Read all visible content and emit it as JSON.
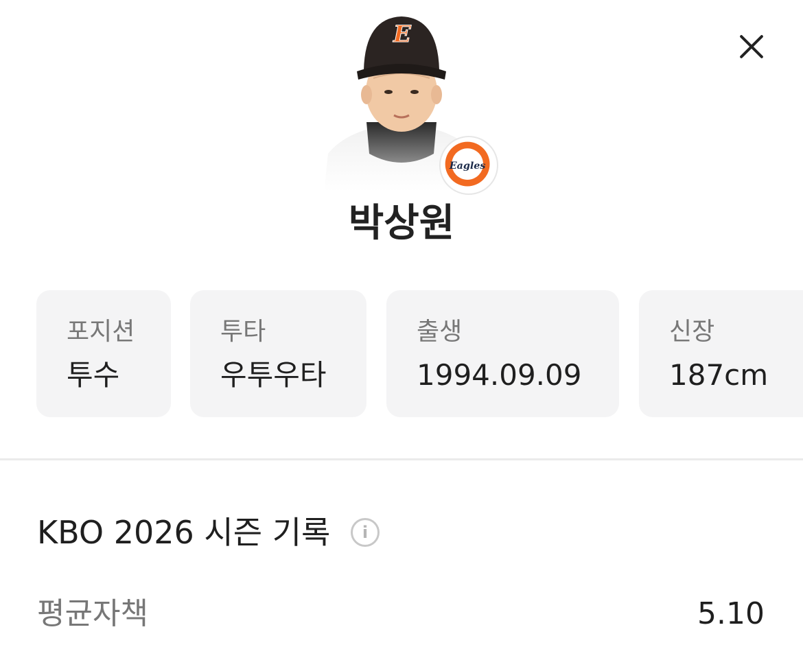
{
  "player": {
    "name": "박상원",
    "cap_letter": "E",
    "team_logo_text": "Eagles"
  },
  "profile_cards": [
    {
      "label": "포지션",
      "value": "투수"
    },
    {
      "label": "투타",
      "value": "우투우타"
    },
    {
      "label": "출생",
      "value": "1994.09.09"
    },
    {
      "label": "신장",
      "value": "187cm"
    }
  ],
  "season": {
    "title": "KBO 2026 시즌 기록",
    "info_icon": "i",
    "stats": [
      {
        "label": "평균자책",
        "value": "5.10"
      }
    ]
  },
  "icons": {
    "close": "close-icon",
    "info": "info-icon"
  },
  "colors": {
    "team_orange": "#f26a21",
    "card_bg": "#f4f4f5"
  }
}
